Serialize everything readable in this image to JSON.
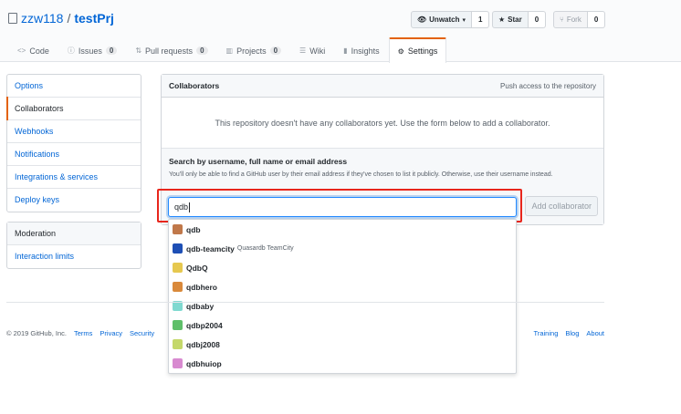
{
  "repo": {
    "owner": "zzw118",
    "separator": "/",
    "name": "testPrj"
  },
  "actions": {
    "watch": {
      "label": "Unwatch",
      "count": "1"
    },
    "star": {
      "label": "Star",
      "count": "0"
    },
    "fork": {
      "label": "Fork",
      "count": "0"
    }
  },
  "tabs": [
    {
      "label": "Code",
      "icon": "code-icon",
      "counter": ""
    },
    {
      "label": "Issues",
      "icon": "issue-icon",
      "counter": "0"
    },
    {
      "label": "Pull requests",
      "icon": "pull-request-icon",
      "counter": "0"
    },
    {
      "label": "Projects",
      "icon": "project-icon",
      "counter": "0"
    },
    {
      "label": "Wiki",
      "icon": "book-icon",
      "counter": ""
    },
    {
      "label": "Insights",
      "icon": "graph-icon",
      "counter": ""
    },
    {
      "label": "Settings",
      "icon": "gear-icon",
      "counter": ""
    }
  ],
  "settings_menu": [
    "Options",
    "Collaborators",
    "Webhooks",
    "Notifications",
    "Integrations & services",
    "Deploy keys"
  ],
  "moderation_menu": {
    "heading": "Moderation",
    "items": [
      "Interaction limits"
    ]
  },
  "collaborators": {
    "title": "Collaborators",
    "note": "Push access to the repository",
    "empty_message": "This repository doesn't have any collaborators yet. Use the form below to add a collaborator.",
    "search_label": "Search by username, full name or email address",
    "search_help": "You'll only be able to find a GitHub user by their email address if they've chosen to list it publicly. Otherwise, use their username instead.",
    "search_value": "qdb",
    "add_button": "Add collaborator"
  },
  "suggestions": [
    {
      "login": "qdb",
      "name": "",
      "color": "#c0784a"
    },
    {
      "login": "qdb-teamcity",
      "name": "Quasardb TeamCity",
      "color": "#1e4fb5"
    },
    {
      "login": "QdbQ",
      "name": "",
      "color": "#e6c84f"
    },
    {
      "login": "qdbhero",
      "name": "",
      "color": "#d9893b"
    },
    {
      "login": "qdbaby",
      "name": "",
      "color": "#7fd9d0"
    },
    {
      "login": "qdbp2004",
      "name": "",
      "color": "#5fbf6a"
    },
    {
      "login": "qdbj2008",
      "name": "",
      "color": "#c4d86a"
    },
    {
      "login": "qdbhuiop",
      "name": "",
      "color": "#d88ad0"
    }
  ],
  "footer": {
    "copyright": "© 2019 GitHub, Inc.",
    "left_links": [
      "Terms",
      "Privacy",
      "Security"
    ],
    "right_links": [
      "Training",
      "Blog",
      "About"
    ]
  },
  "colors": {
    "accent": "#e36209",
    "link": "#0366d6",
    "highlight_box": "#e8261c"
  }
}
